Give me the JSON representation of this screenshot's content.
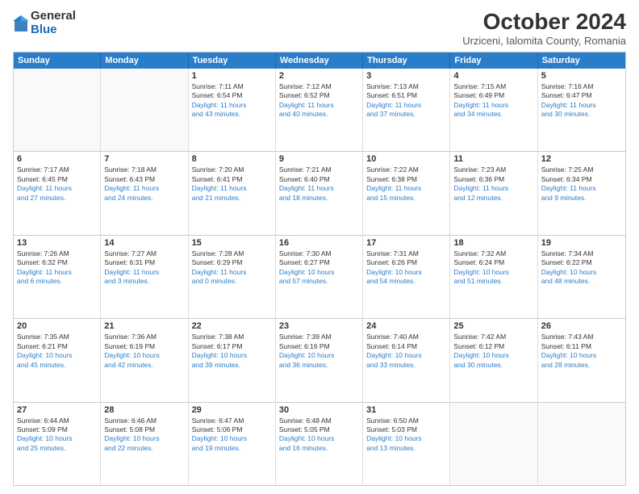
{
  "logo": {
    "general": "General",
    "blue": "Blue"
  },
  "title": "October 2024",
  "subtitle": "Urziceni, Ialomita County, Romania",
  "weekdays": [
    "Sunday",
    "Monday",
    "Tuesday",
    "Wednesday",
    "Thursday",
    "Friday",
    "Saturday"
  ],
  "weeks": [
    [
      {
        "day": "",
        "sunrise": "",
        "sunset": "",
        "daylight": "",
        "shaded": true
      },
      {
        "day": "",
        "sunrise": "",
        "sunset": "",
        "daylight": "",
        "shaded": true
      },
      {
        "day": "1",
        "sunrise": "Sunrise: 7:11 AM",
        "sunset": "Sunset: 6:54 PM",
        "daylight": "Daylight: 11 hours and 43 minutes."
      },
      {
        "day": "2",
        "sunrise": "Sunrise: 7:12 AM",
        "sunset": "Sunset: 6:52 PM",
        "daylight": "Daylight: 11 hours and 40 minutes."
      },
      {
        "day": "3",
        "sunrise": "Sunrise: 7:13 AM",
        "sunset": "Sunset: 6:51 PM",
        "daylight": "Daylight: 11 hours and 37 minutes."
      },
      {
        "day": "4",
        "sunrise": "Sunrise: 7:15 AM",
        "sunset": "Sunset: 6:49 PM",
        "daylight": "Daylight: 11 hours and 34 minutes."
      },
      {
        "day": "5",
        "sunrise": "Sunrise: 7:16 AM",
        "sunset": "Sunset: 6:47 PM",
        "daylight": "Daylight: 11 hours and 30 minutes."
      }
    ],
    [
      {
        "day": "6",
        "sunrise": "Sunrise: 7:17 AM",
        "sunset": "Sunset: 6:45 PM",
        "daylight": "Daylight: 11 hours and 27 minutes."
      },
      {
        "day": "7",
        "sunrise": "Sunrise: 7:18 AM",
        "sunset": "Sunset: 6:43 PM",
        "daylight": "Daylight: 11 hours and 24 minutes."
      },
      {
        "day": "8",
        "sunrise": "Sunrise: 7:20 AM",
        "sunset": "Sunset: 6:41 PM",
        "daylight": "Daylight: 11 hours and 21 minutes."
      },
      {
        "day": "9",
        "sunrise": "Sunrise: 7:21 AM",
        "sunset": "Sunset: 6:40 PM",
        "daylight": "Daylight: 11 hours and 18 minutes."
      },
      {
        "day": "10",
        "sunrise": "Sunrise: 7:22 AM",
        "sunset": "Sunset: 6:38 PM",
        "daylight": "Daylight: 11 hours and 15 minutes."
      },
      {
        "day": "11",
        "sunrise": "Sunrise: 7:23 AM",
        "sunset": "Sunset: 6:36 PM",
        "daylight": "Daylight: 11 hours and 12 minutes."
      },
      {
        "day": "12",
        "sunrise": "Sunrise: 7:25 AM",
        "sunset": "Sunset: 6:34 PM",
        "daylight": "Daylight: 11 hours and 9 minutes."
      }
    ],
    [
      {
        "day": "13",
        "sunrise": "Sunrise: 7:26 AM",
        "sunset": "Sunset: 6:32 PM",
        "daylight": "Daylight: 11 hours and 6 minutes."
      },
      {
        "day": "14",
        "sunrise": "Sunrise: 7:27 AM",
        "sunset": "Sunset: 6:31 PM",
        "daylight": "Daylight: 11 hours and 3 minutes."
      },
      {
        "day": "15",
        "sunrise": "Sunrise: 7:28 AM",
        "sunset": "Sunset: 6:29 PM",
        "daylight": "Daylight: 11 hours and 0 minutes."
      },
      {
        "day": "16",
        "sunrise": "Sunrise: 7:30 AM",
        "sunset": "Sunset: 6:27 PM",
        "daylight": "Daylight: 10 hours and 57 minutes."
      },
      {
        "day": "17",
        "sunrise": "Sunrise: 7:31 AM",
        "sunset": "Sunset: 6:26 PM",
        "daylight": "Daylight: 10 hours and 54 minutes."
      },
      {
        "day": "18",
        "sunrise": "Sunrise: 7:32 AM",
        "sunset": "Sunset: 6:24 PM",
        "daylight": "Daylight: 10 hours and 51 minutes."
      },
      {
        "day": "19",
        "sunrise": "Sunrise: 7:34 AM",
        "sunset": "Sunset: 6:22 PM",
        "daylight": "Daylight: 10 hours and 48 minutes."
      }
    ],
    [
      {
        "day": "20",
        "sunrise": "Sunrise: 7:35 AM",
        "sunset": "Sunset: 6:21 PM",
        "daylight": "Daylight: 10 hours and 45 minutes."
      },
      {
        "day": "21",
        "sunrise": "Sunrise: 7:36 AM",
        "sunset": "Sunset: 6:19 PM",
        "daylight": "Daylight: 10 hours and 42 minutes."
      },
      {
        "day": "22",
        "sunrise": "Sunrise: 7:38 AM",
        "sunset": "Sunset: 6:17 PM",
        "daylight": "Daylight: 10 hours and 39 minutes."
      },
      {
        "day": "23",
        "sunrise": "Sunrise: 7:39 AM",
        "sunset": "Sunset: 6:16 PM",
        "daylight": "Daylight: 10 hours and 36 minutes."
      },
      {
        "day": "24",
        "sunrise": "Sunrise: 7:40 AM",
        "sunset": "Sunset: 6:14 PM",
        "daylight": "Daylight: 10 hours and 33 minutes."
      },
      {
        "day": "25",
        "sunrise": "Sunrise: 7:42 AM",
        "sunset": "Sunset: 6:12 PM",
        "daylight": "Daylight: 10 hours and 30 minutes."
      },
      {
        "day": "26",
        "sunrise": "Sunrise: 7:43 AM",
        "sunset": "Sunset: 6:11 PM",
        "daylight": "Daylight: 10 hours and 28 minutes."
      }
    ],
    [
      {
        "day": "27",
        "sunrise": "Sunrise: 6:44 AM",
        "sunset": "Sunset: 5:09 PM",
        "daylight": "Daylight: 10 hours and 25 minutes."
      },
      {
        "day": "28",
        "sunrise": "Sunrise: 6:46 AM",
        "sunset": "Sunset: 5:08 PM",
        "daylight": "Daylight: 10 hours and 22 minutes."
      },
      {
        "day": "29",
        "sunrise": "Sunrise: 6:47 AM",
        "sunset": "Sunset: 5:06 PM",
        "daylight": "Daylight: 10 hours and 19 minutes."
      },
      {
        "day": "30",
        "sunrise": "Sunrise: 6:48 AM",
        "sunset": "Sunset: 5:05 PM",
        "daylight": "Daylight: 10 hours and 16 minutes."
      },
      {
        "day": "31",
        "sunrise": "Sunrise: 6:50 AM",
        "sunset": "Sunset: 5:03 PM",
        "daylight": "Daylight: 10 hours and 13 minutes."
      },
      {
        "day": "",
        "sunrise": "",
        "sunset": "",
        "daylight": "",
        "shaded": true
      },
      {
        "day": "",
        "sunrise": "",
        "sunset": "",
        "daylight": "",
        "shaded": true
      }
    ]
  ]
}
